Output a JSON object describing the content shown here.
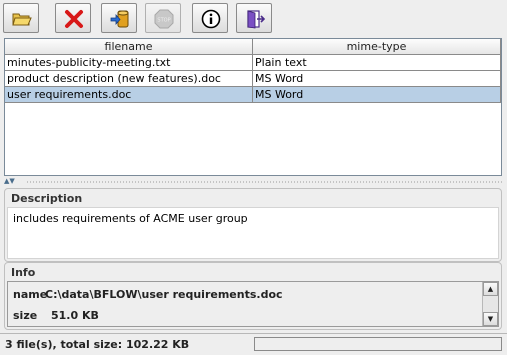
{
  "toolbar": {
    "buttons": [
      {
        "name": "open-folder-button",
        "icon": "folder-open-icon",
        "enabled": true
      },
      {
        "name": "delete-button",
        "icon": "red-x-icon",
        "enabled": true
      },
      {
        "name": "import-button",
        "icon": "import-icon",
        "enabled": true
      },
      {
        "name": "stop-button",
        "icon": "stop-icon",
        "enabled": false
      },
      {
        "name": "info-button",
        "icon": "info-icon",
        "enabled": true
      },
      {
        "name": "exit-button",
        "icon": "exit-door-icon",
        "enabled": true
      }
    ]
  },
  "table": {
    "columns": [
      "filename",
      "mime-type"
    ],
    "rows": [
      {
        "filename": "minutes-publicity-meeting.txt",
        "mime": "Plain text",
        "selected": false
      },
      {
        "filename": "product description (new features).doc",
        "mime": "MS Word",
        "selected": false
      },
      {
        "filename": "user requirements.doc",
        "mime": "MS Word",
        "selected": true
      }
    ]
  },
  "description": {
    "title": "Description",
    "text": "includes requirements of ACME user group"
  },
  "info": {
    "title": "Info",
    "name_label": "name",
    "name_value": "C:\\data\\BFLOW\\user requirements.doc",
    "size_label": "size",
    "size_value": "51.0 KB"
  },
  "status": {
    "text": "3 file(s), total size: 102.22 KB",
    "progress": 0
  },
  "colors": {
    "selection": "#b8cfe5",
    "accent": "#4a6d8c"
  }
}
